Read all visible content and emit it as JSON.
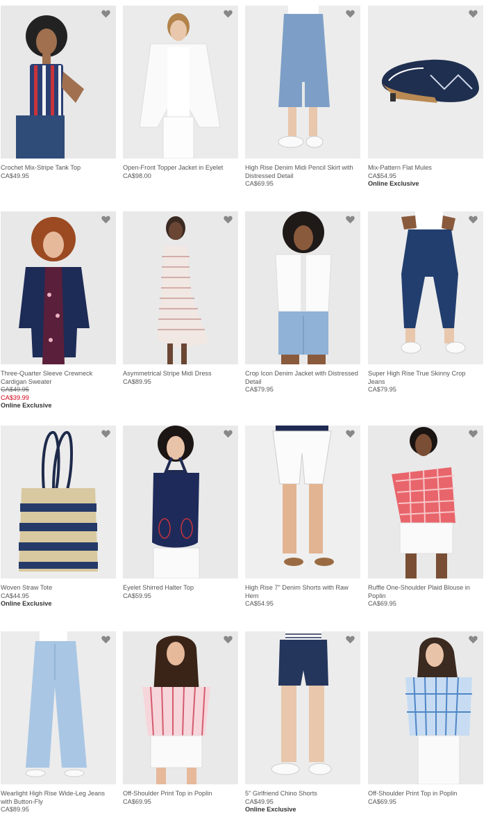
{
  "icons": {
    "favorite": "heart-icon"
  },
  "colors": {
    "background": "#ffffff",
    "tile": "#e9e9e9",
    "sale": "#d0021b"
  },
  "products": [
    {
      "title": "Crochet Mix-Stripe Tank Top",
      "price": "CA$49.95",
      "original_price": "",
      "sale_price": "",
      "badge": ""
    },
    {
      "title": "Open-Front Topper Jacket in Eyelet",
      "price": "CA$98.00",
      "original_price": "",
      "sale_price": "",
      "badge": ""
    },
    {
      "title": "High Rise Denim Midi Pencil Skirt with Distressed Detail",
      "price": "CA$69.95",
      "original_price": "",
      "sale_price": "",
      "badge": ""
    },
    {
      "title": "Mix-Pattern Flat Mules",
      "price": "CA$54.95",
      "original_price": "",
      "sale_price": "",
      "badge": "Online Exclusive"
    },
    {
      "title": "Three-Quarter Sleeve Crewneck Cardigan Sweater",
      "price": "",
      "original_price": "CA$49.95",
      "sale_price": "CA$39.99",
      "badge": "Online Exclusive"
    },
    {
      "title": "Asymmetrical Stripe Midi Dress",
      "price": "CA$89.95",
      "original_price": "",
      "sale_price": "",
      "badge": ""
    },
    {
      "title": "Crop Icon Denim Jacket with Distressed Detail",
      "price": "CA$79.95",
      "original_price": "",
      "sale_price": "",
      "badge": ""
    },
    {
      "title": "Super High Rise True Skinny Crop Jeans",
      "price": "CA$79.95",
      "original_price": "",
      "sale_price": "",
      "badge": ""
    },
    {
      "title": "Woven Straw Tote",
      "price": "CA$44.95",
      "original_price": "",
      "sale_price": "",
      "badge": "Online Exclusive"
    },
    {
      "title": "Eyelet Shirred Halter Top",
      "price": "CA$59.95",
      "original_price": "",
      "sale_price": "",
      "badge": ""
    },
    {
      "title": "High Rise 7\" Denim Shorts with Raw Hem",
      "price": "CA$54.95",
      "original_price": "",
      "sale_price": "",
      "badge": ""
    },
    {
      "title": "Ruffle One-Shoulder Plaid Blouse in Poplin",
      "price": "CA$69.95",
      "original_price": "",
      "sale_price": "",
      "badge": ""
    },
    {
      "title": "Wearlight High Rise Wide-Leg Jeans with Button-Fly",
      "price": "CA$89.95",
      "original_price": "",
      "sale_price": "",
      "badge": ""
    },
    {
      "title": "Off-Shoulder Print Top in Poplin",
      "price": "CA$69.95",
      "original_price": "",
      "sale_price": "",
      "badge": ""
    },
    {
      "title": "5\" Girlfriend Chino Shorts",
      "price": "CA$49.95",
      "original_price": "",
      "sale_price": "",
      "badge": "Online Exclusive"
    },
    {
      "title": "Off-Shoulder Print Top in Poplin",
      "price": "CA$69.95",
      "original_price": "",
      "sale_price": "",
      "badge": ""
    }
  ]
}
